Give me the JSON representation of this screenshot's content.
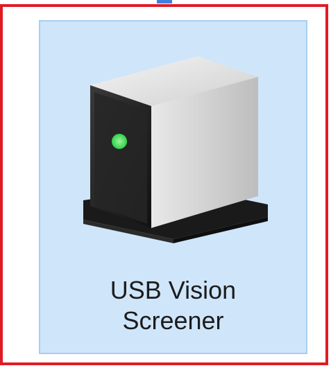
{
  "device": {
    "name_line1": "USB Vision",
    "name_line2": "Screener",
    "icon": "drive-icon",
    "status_led_color": "#2fd24a"
  },
  "colors": {
    "selection_fill": "#cfe5fa",
    "selection_border": "#a7cef0",
    "highlight_frame": "#e01b24"
  }
}
